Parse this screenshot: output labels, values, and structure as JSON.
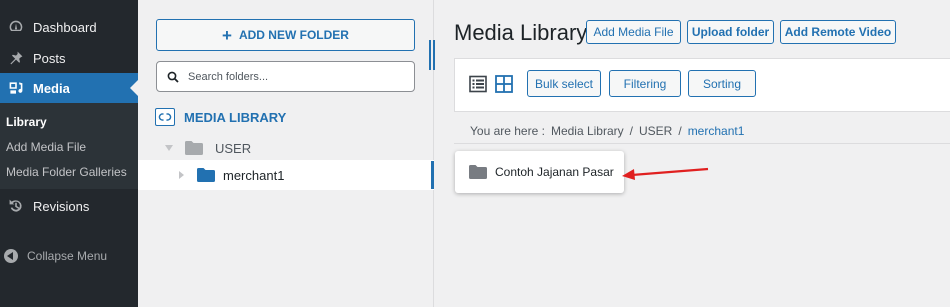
{
  "sidebar": {
    "items": [
      {
        "label": "Dashboard",
        "icon": "dashboard-icon"
      },
      {
        "label": "Posts",
        "icon": "pin-icon"
      },
      {
        "label": "Media",
        "icon": "media-icon"
      }
    ],
    "submenu": [
      "Library",
      "Add Media File",
      "Media Folder Galleries"
    ],
    "revisions": "Revisions",
    "collapse": "Collapse Menu"
  },
  "folders": {
    "add_button": "ADD NEW FOLDER",
    "search_placeholder": "Search folders...",
    "root_label": "MEDIA LIBRARY",
    "tree": [
      {
        "label": "USER"
      },
      {
        "label": "merchant1"
      }
    ]
  },
  "main": {
    "title": "Media Library",
    "header_buttons": [
      "Add Media File",
      "Upload folder",
      "Add Remote Video"
    ],
    "toolbar_buttons": [
      "Bulk select",
      "Filtering",
      "Sorting"
    ],
    "breadcrumb": {
      "prefix": "You are here :",
      "items": [
        "Media Library",
        "USER",
        "merchant1"
      ]
    },
    "folder_card": "Contoh Jajanan Pasar"
  },
  "colors": {
    "accent": "#2271b1",
    "sidebar_bg": "#23282d",
    "arrow": "#e02020"
  }
}
